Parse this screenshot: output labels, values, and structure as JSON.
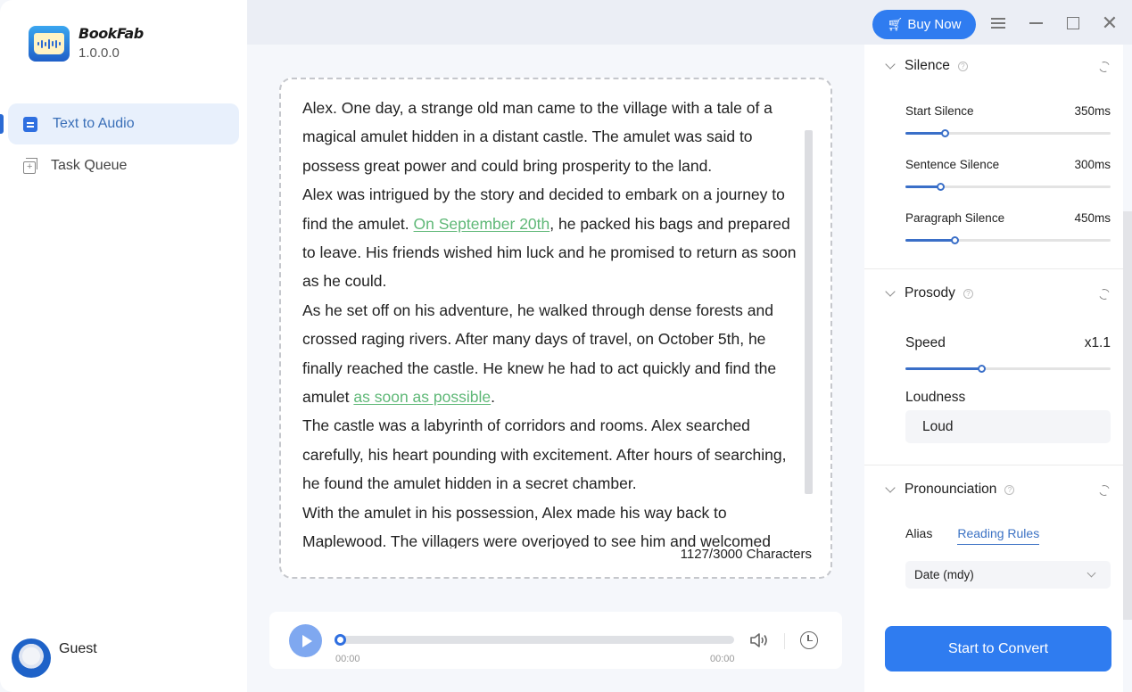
{
  "app": {
    "name": "BookFab",
    "version": "1.0.0.0"
  },
  "sidebar": {
    "items": [
      {
        "label": "Text to Audio",
        "icon": "document-icon",
        "active": true
      },
      {
        "label": "Task Queue",
        "icon": "task-queue-icon",
        "active": false
      }
    ],
    "user": {
      "name": "Guest"
    }
  },
  "topbar": {
    "buy_label": "Buy Now",
    "window_controls": [
      "menu-icon",
      "minimize-icon",
      "maximize-icon",
      "close-icon"
    ]
  },
  "editor": {
    "paragraphs": [
      [
        {
          "t": "Alex. One day, a strange old man came to the village with a tale of a magical amulet hidden in a distant castle. The amulet was said to possess great power and could bring prosperity to the land."
        }
      ],
      [
        {
          "t": "Alex was intrigued by the story and decided to embark on a journey to find the amulet. "
        },
        {
          "t": "On September 20th",
          "hl": true
        },
        {
          "t": ", he packed his bags and prepared to leave. His friends wished him luck and he promised to return as soon as he could."
        }
      ],
      [
        {
          "t": "As he set off on his adventure, he walked through dense forests and crossed raging rivers. After many days of travel, on October 5th, he finally reached the castle. He knew he had to act quickly and find the amulet "
        },
        {
          "t": "as soon as possible",
          "hl": true
        },
        {
          "t": "."
        }
      ],
      [
        {
          "t": "The castle was a labyrinth of corridors and rooms. Alex searched carefully, his heart pounding with excitement. After hours of searching, he found the amulet hidden in a secret chamber."
        }
      ],
      [
        {
          "t": "With the amulet in his possession, Alex made his way back to Maplewood. The villagers were overjoyed to see him and welcomed"
        }
      ]
    ],
    "char_count": "1127/3000 Characters",
    "highlight_color": "#5fb877"
  },
  "player": {
    "current_time": "00:00",
    "total_time": "00:00",
    "progress": 0
  },
  "settings": {
    "silence": {
      "title": "Silence",
      "rows": [
        {
          "label": "Start Silence",
          "value": "350ms",
          "fraction": 0.19
        },
        {
          "label": "Sentence Silence",
          "value": "300ms",
          "fraction": 0.17
        },
        {
          "label": "Paragraph Silence",
          "value": "450ms",
          "fraction": 0.24
        }
      ]
    },
    "prosody": {
      "title": "Prosody",
      "speed_label": "Speed",
      "speed_value": "x1.1",
      "speed_fraction": 0.37,
      "loudness_label": "Loudness",
      "loudness_value": "Loud"
    },
    "pronunciation": {
      "title": "Pronounciation",
      "tabs": [
        {
          "label": "Alias",
          "active": false
        },
        {
          "label": "Reading Rules",
          "active": true
        }
      ],
      "rule_select": "Date (mdy)"
    },
    "convert_label": "Start to Convert"
  },
  "colors": {
    "accent": "#2f7cf0",
    "slider": "#3a6fc8",
    "active_tab": "#3b72c4"
  }
}
